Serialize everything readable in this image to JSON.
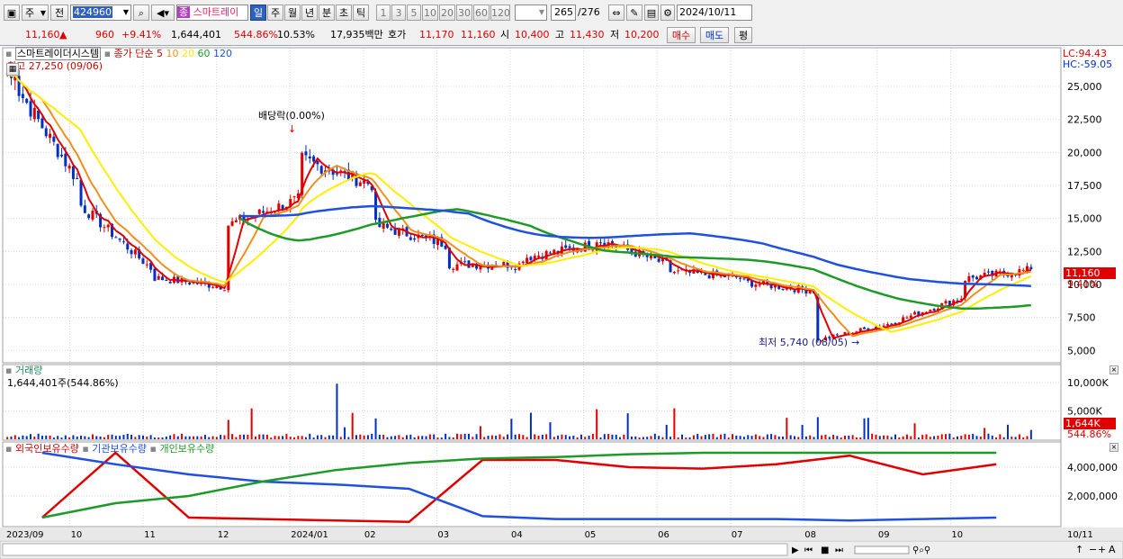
{
  "toolbar": {
    "kind_label": "주",
    "prev_label": "전",
    "code_value": "424960",
    "stock_name": "스마트레이",
    "stock_badge": "종",
    "periods": [
      "일",
      "주",
      "월",
      "년",
      "분",
      "초",
      "틱"
    ],
    "intervals": [
      "1",
      "3",
      "5",
      "10",
      "20",
      "30",
      "60",
      "120"
    ],
    "count_current": "265",
    "count_total": "/276",
    "date_value": "2024/10/11"
  },
  "quote": {
    "price": "11,160",
    "change_symbol": "▲",
    "change": "960",
    "change_pct": "+9.41%",
    "volume": "1,644,401",
    "volume_ratio": "544.86%",
    "turnover": "10.53%",
    "amount": "17,935백만",
    "ask_label": "호가",
    "ask": "11,170",
    "bid": "11,160",
    "open_label": "시",
    "open": "10,400",
    "high_label": "고",
    "high": "11,430",
    "low_label": "저",
    "low": "10,200",
    "buy_label": "매수",
    "sell_label": "매도",
    "eval_label": "평"
  },
  "price_panel": {
    "title": "스마트레이더시스템",
    "series_label": "종가 단순",
    "ma_periods": [
      "5",
      "10",
      "20",
      "60",
      "120"
    ],
    "ma_colors": [
      "#e00000",
      "#f0901c",
      "#ffee00",
      "#1e9a28",
      "#2050e0"
    ],
    "high_marker": "최고 27,250 (09/06)",
    "low_marker": "최저 5,740 (08/05)",
    "dividend_marker": "배당락(0.00%)",
    "lc_label": "LC:94.43",
    "hc_label": "HC:-59.05",
    "current_tag": "11,160",
    "current_pct_tag": "9.41%",
    "y_ticks": [
      "25,000",
      "22,500",
      "20,000",
      "17,500",
      "15,000",
      "12,500",
      "10,000",
      "7,500",
      "5,000"
    ]
  },
  "volume_panel": {
    "title": "거래량",
    "value_text": "1,644,401주(544.86%)",
    "y_ticks": [
      "10,000K",
      "5,000K"
    ],
    "current_tag": "1,644K",
    "current_pct_tag": "544.86%"
  },
  "holdings_panel": {
    "labels": [
      "외국인보유수량",
      "기관보유수량",
      "개인보유수량"
    ],
    "colors": [
      "#e00000",
      "#2050e0",
      "#1e9a28"
    ],
    "y_ticks": [
      "4,000,000",
      "2,000,000"
    ]
  },
  "x_axis": {
    "labels": [
      "2023/09",
      "10",
      "11",
      "12",
      "2024/01",
      "02",
      "03",
      "04",
      "05",
      "06",
      "07",
      "08",
      "09",
      "10"
    ],
    "right_label": "10/11"
  },
  "chart_data": {
    "type": "candlestick",
    "title": "",
    "ylabel": "",
    "ylim": [
      4200,
      27800
    ],
    "months": [
      "2023/09",
      "10",
      "11",
      "12",
      "2024/01",
      "02",
      "03",
      "04",
      "05",
      "06",
      "07",
      "08",
      "09",
      "10"
    ],
    "close_checkpoints": [
      {
        "month": "2023/09",
        "start": 26000,
        "end": 17500
      },
      {
        "month": "10",
        "start": 16000,
        "end": 11000
      },
      {
        "month": "11",
        "start": 10500,
        "end": 9800
      },
      {
        "month": "12",
        "start": 14500,
        "end": 16500
      },
      {
        "month": "2024/01",
        "start": 19500,
        "end": 17500
      },
      {
        "month": "02",
        "start": 14500,
        "end": 13000
      },
      {
        "month": "03",
        "start": 11500,
        "end": 11500
      },
      {
        "month": "04",
        "start": 12000,
        "end": 13000
      },
      {
        "month": "05",
        "start": 13500,
        "end": 11500
      },
      {
        "month": "06",
        "start": 11000,
        "end": 10500
      },
      {
        "month": "07",
        "start": 10200,
        "end": 9500
      },
      {
        "month": "08",
        "start": 5740,
        "end": 7000
      },
      {
        "month": "09",
        "start": 7000,
        "end": 9000
      },
      {
        "month": "10",
        "start": 10400,
        "end": 11160
      }
    ],
    "high": {
      "value": 27250,
      "date": "09/06"
    },
    "low": {
      "value": 5740,
      "date": "08/05"
    },
    "last_close": 11160,
    "volume_max": 10000000,
    "volume_last": 1644401,
    "holdings_ylim": [
      0,
      5000000
    ],
    "holdings_series": [
      {
        "name": "외국인보유수량",
        "points": [
          500000,
          5000000,
          500000,
          400000,
          300000,
          200000,
          4500000,
          4500000,
          4000000,
          3900000,
          4200000,
          4800000,
          3500000,
          4200000
        ]
      },
      {
        "name": "기관보유수량",
        "points": [
          5000000,
          4200000,
          3500000,
          3000000,
          2800000,
          2500000,
          600000,
          400000,
          400000,
          400000,
          400000,
          300000,
          400000,
          500000
        ]
      },
      {
        "name": "개인보유수량",
        "points": [
          500000,
          1500000,
          2000000,
          3000000,
          3800000,
          4300000,
          4600000,
          4700000,
          4900000,
          5000000,
          5000000,
          5000000,
          5000000,
          5000000
        ]
      }
    ]
  }
}
